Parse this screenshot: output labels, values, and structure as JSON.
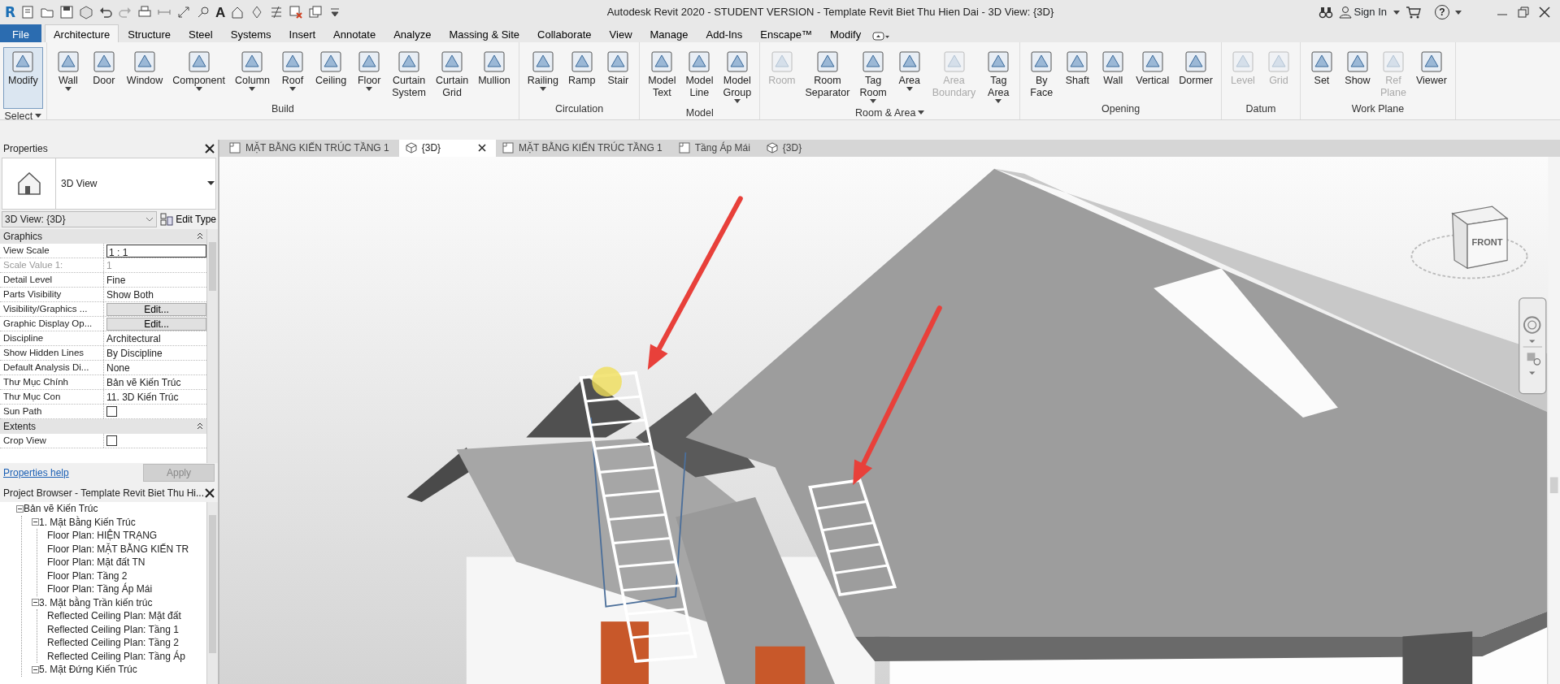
{
  "app_logo": "R",
  "text_tool_glyph": "A",
  "window": {
    "title": "Autodesk Revit 2020 - STUDENT VERSION - Template Revit Biet Thu Hien Dai - 3D View: {3D}",
    "sign_in": "Sign In",
    "help_glyph": "?"
  },
  "ribbon_tabs": [
    {
      "label": "File",
      "kind": "file",
      "selected": false
    },
    {
      "label": "Architecture",
      "kind": "tab",
      "selected": true
    },
    {
      "label": "Structure",
      "kind": "tab",
      "selected": false
    },
    {
      "label": "Steel",
      "kind": "tab",
      "selected": false
    },
    {
      "label": "Systems",
      "kind": "tab",
      "selected": false
    },
    {
      "label": "Insert",
      "kind": "tab",
      "selected": false
    },
    {
      "label": "Annotate",
      "kind": "tab",
      "selected": false
    },
    {
      "label": "Analyze",
      "kind": "tab",
      "selected": false
    },
    {
      "label": "Massing & Site",
      "kind": "tab",
      "selected": false
    },
    {
      "label": "Collaborate",
      "kind": "tab",
      "selected": false
    },
    {
      "label": "View",
      "kind": "tab",
      "selected": false
    },
    {
      "label": "Manage",
      "kind": "tab",
      "selected": false
    },
    {
      "label": "Add-Ins",
      "kind": "tab",
      "selected": false
    },
    {
      "label": "Enscape™",
      "kind": "tab",
      "selected": false
    },
    {
      "label": "Modify",
      "kind": "tab",
      "selected": false
    }
  ],
  "ribbon_panels": [
    {
      "title": "Select",
      "menu": true,
      "tools": [
        {
          "label": "Modify",
          "menu": false,
          "disabled": false,
          "selected": true
        }
      ]
    },
    {
      "title": "Build",
      "menu": false,
      "tools": [
        {
          "label": "Wall",
          "menu": true,
          "disabled": false,
          "selected": false
        },
        {
          "label": "Door",
          "menu": false,
          "disabled": false,
          "selected": false
        },
        {
          "label": "Window",
          "menu": false,
          "disabled": false,
          "selected": false
        },
        {
          "label": "Component",
          "menu": true,
          "disabled": false,
          "selected": false
        },
        {
          "label": "Column",
          "menu": true,
          "disabled": false,
          "selected": false
        },
        {
          "label": "Roof",
          "menu": true,
          "disabled": false,
          "selected": false
        },
        {
          "label": "Ceiling",
          "menu": false,
          "disabled": false,
          "selected": false
        },
        {
          "label": "Floor",
          "menu": true,
          "disabled": false,
          "selected": false
        },
        {
          "label": "Curtain System",
          "menu": false,
          "disabled": false,
          "selected": false
        },
        {
          "label": "Curtain Grid",
          "menu": false,
          "disabled": false,
          "selected": false
        },
        {
          "label": "Mullion",
          "menu": false,
          "disabled": false,
          "selected": false
        }
      ]
    },
    {
      "title": "Circulation",
      "menu": false,
      "tools": [
        {
          "label": "Railing",
          "menu": true,
          "disabled": false,
          "selected": false
        },
        {
          "label": "Ramp",
          "menu": false,
          "disabled": false,
          "selected": false
        },
        {
          "label": "Stair",
          "menu": false,
          "disabled": false,
          "selected": false
        }
      ]
    },
    {
      "title": "Model",
      "menu": false,
      "tools": [
        {
          "label": "Model Text",
          "menu": false,
          "disabled": false,
          "selected": false
        },
        {
          "label": "Model Line",
          "menu": false,
          "disabled": false,
          "selected": false
        },
        {
          "label": "Model Group",
          "menu": true,
          "disabled": false,
          "selected": false
        }
      ]
    },
    {
      "title": "Room & Area",
      "menu": true,
      "tools": [
        {
          "label": "Room",
          "menu": false,
          "disabled": true,
          "selected": false
        },
        {
          "label": "Room Separator",
          "menu": false,
          "disabled": false,
          "selected": false
        },
        {
          "label": "Tag Room",
          "menu": true,
          "disabled": false,
          "selected": false
        },
        {
          "label": "Area",
          "menu": true,
          "disabled": false,
          "selected": false
        },
        {
          "label": "Area Boundary",
          "menu": false,
          "disabled": true,
          "selected": false
        },
        {
          "label": "Tag Area",
          "menu": true,
          "disabled": false,
          "selected": false
        }
      ]
    },
    {
      "title": "Opening",
      "menu": false,
      "tools": [
        {
          "label": "By Face",
          "menu": false,
          "disabled": false,
          "selected": false
        },
        {
          "label": "Shaft",
          "menu": false,
          "disabled": false,
          "selected": false
        },
        {
          "label": "Wall",
          "menu": false,
          "disabled": false,
          "selected": false
        },
        {
          "label": "Vertical",
          "menu": false,
          "disabled": false,
          "selected": false
        },
        {
          "label": "Dormer",
          "menu": false,
          "disabled": false,
          "selected": false
        }
      ]
    },
    {
      "title": "Datum",
      "menu": false,
      "tools": [
        {
          "label": "Level",
          "menu": false,
          "disabled": true,
          "selected": false
        },
        {
          "label": "Grid",
          "menu": false,
          "disabled": true,
          "selected": false
        }
      ]
    },
    {
      "title": "Work Plane",
      "menu": false,
      "tools": [
        {
          "label": "Set",
          "menu": false,
          "disabled": false,
          "selected": false
        },
        {
          "label": "Show",
          "menu": false,
          "disabled": false,
          "selected": false
        },
        {
          "label": "Ref Plane",
          "menu": false,
          "disabled": true,
          "selected": false
        },
        {
          "label": "Viewer",
          "menu": false,
          "disabled": false,
          "selected": false
        }
      ]
    }
  ],
  "properties": {
    "title": "Properties",
    "type_name": "3D View",
    "instance": "3D View: {3D}",
    "edit_type": "Edit Type",
    "groups": [
      {
        "title": "Graphics",
        "rows": [
          {
            "name": "View Scale",
            "kind": "input",
            "value": "1 : 1",
            "disabled": false
          },
          {
            "name": "Scale Value    1:",
            "kind": "text",
            "value": "1",
            "disabled": true
          },
          {
            "name": "Detail Level",
            "kind": "text",
            "value": "Fine",
            "disabled": false
          },
          {
            "name": "Parts Visibility",
            "kind": "text",
            "value": "Show Both",
            "disabled": false
          },
          {
            "name": "Visibility/Graphics ...",
            "kind": "button",
            "value": "Edit...",
            "disabled": false
          },
          {
            "name": "Graphic Display Op...",
            "kind": "button",
            "value": "Edit...",
            "disabled": false
          },
          {
            "name": "Discipline",
            "kind": "text",
            "value": "Architectural",
            "disabled": false
          },
          {
            "name": "Show Hidden Lines",
            "kind": "text",
            "value": "By Discipline",
            "disabled": false
          },
          {
            "name": "Default Analysis Di...",
            "kind": "text",
            "value": "None",
            "disabled": false
          },
          {
            "name": "Thư Mục Chính",
            "kind": "text",
            "value": "Bản vẽ Kiến Trúc",
            "disabled": false
          },
          {
            "name": "Thư Mục Con",
            "kind": "text",
            "value": "11. 3D Kiến Trúc",
            "disabled": false
          },
          {
            "name": "Sun Path",
            "kind": "checkbox",
            "checked": false,
            "disabled": false
          }
        ]
      },
      {
        "title": "Extents",
        "rows": [
          {
            "name": "Crop View",
            "kind": "checkbox",
            "checked": false,
            "disabled": false
          }
        ]
      }
    ],
    "help": "Properties help",
    "apply": "Apply"
  },
  "project_browser": {
    "title": "Project Browser - Template Revit Biet Thu Hi...",
    "tree": [
      {
        "label": "Bản vẽ Kiến Trúc",
        "expanded": true,
        "children": [
          {
            "label": "1. Mặt Bằng Kiến Trúc",
            "expanded": true,
            "children": [
              {
                "label": "Floor Plan: HIỆN TRẠNG"
              },
              {
                "label": "Floor Plan: MẶT BẰNG KIẾN TR"
              },
              {
                "label": "Floor Plan: Mặt đất TN"
              },
              {
                "label": "Floor Plan: Tầng 2"
              },
              {
                "label": "Floor Plan: Tầng Áp Mái"
              }
            ]
          },
          {
            "label": "3. Mặt bằng Trần kiến trúc",
            "expanded": true,
            "children": [
              {
                "label": "Reflected Ceiling Plan: Mặt đất"
              },
              {
                "label": "Reflected Ceiling Plan: Tầng 1"
              },
              {
                "label": "Reflected Ceiling Plan: Tầng 2"
              },
              {
                "label": "Reflected Ceiling Plan: Tầng Áp"
              }
            ]
          },
          {
            "label": "5. Mặt Đứng Kiến Trúc",
            "expanded": true
          }
        ]
      }
    ]
  },
  "view_tabs": [
    {
      "label": "MẶT BẰNG KIẾN TRÚC TẦNG 1",
      "kind": "plan",
      "selected": false
    },
    {
      "label": "{3D}",
      "kind": "model",
      "selected": true
    },
    {
      "label": "MẶT BẰNG KIẾN TRÚC TẦNG 1",
      "kind": "plan",
      "selected": false
    },
    {
      "label": "Tầng Áp Mái",
      "kind": "plan",
      "selected": false
    },
    {
      "label": "{3D}",
      "kind": "model",
      "selected": false
    }
  ],
  "view_cube": {
    "face": "FRONT"
  }
}
